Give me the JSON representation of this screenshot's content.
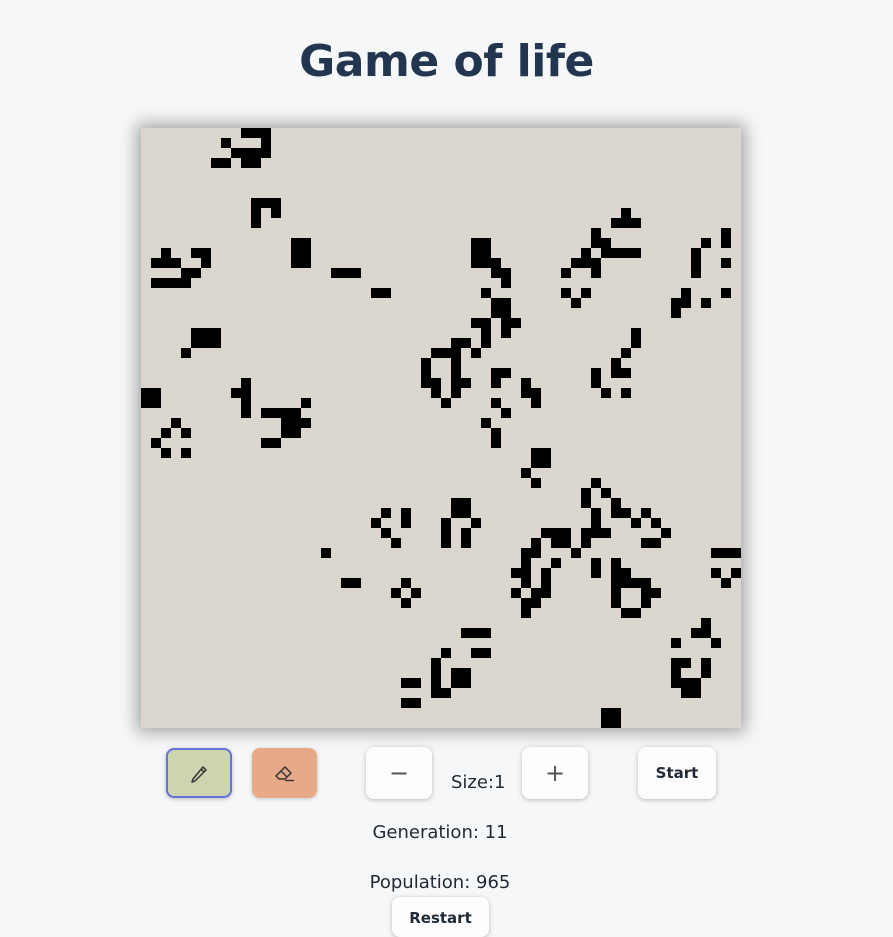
{
  "app": {
    "title": "Game of life"
  },
  "toolbar": {
    "pencil_icon": "pencil-icon",
    "eraser_icon": "eraser-icon",
    "minus_label": "−",
    "plus_label": "+",
    "size_label": "Size:1",
    "start_label": "Start"
  },
  "stats": {
    "generation_text": "Generation: 11",
    "population_text": "Population: 965"
  },
  "actions": {
    "restart_label": "Restart"
  },
  "colors": {
    "page_background": "#f6f7f8",
    "board_background": "#dbd7ce",
    "live_cell": "#000000",
    "title": "#22364f",
    "pencil_active": "#cdd5b0",
    "pencil_border": "#6673d8",
    "eraser": "#e7a988"
  },
  "grid": {
    "rows": 60,
    "cols": 60,
    "seed": 11
  }
}
